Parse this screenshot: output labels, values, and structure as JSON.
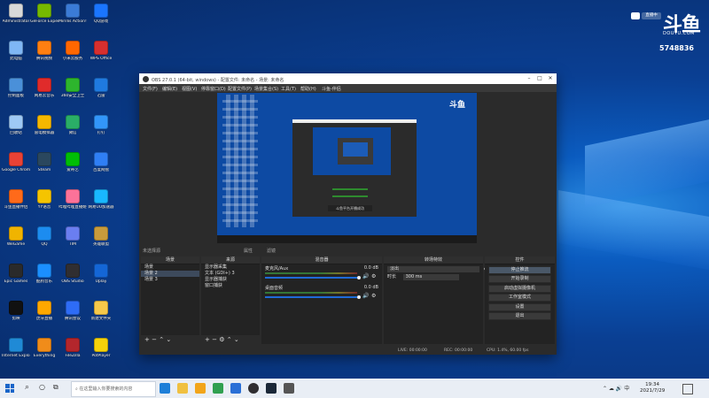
{
  "desktop": {
    "icons": [
      {
        "label": "Administrator",
        "color": "#d9d9d9"
      },
      {
        "label": "GeForce Experience",
        "color": "#76b900"
      },
      {
        "label": "Mirillis Action!",
        "color": "#3b7bd6"
      },
      {
        "label": "QQ游戏",
        "color": "#1a75ff"
      },
      {
        "label": "此电脑",
        "color": "#7fb7f5"
      },
      {
        "label": "腾讯视频",
        "color": "#ff7f11"
      },
      {
        "label": "小米云服务",
        "color": "#ff6700"
      },
      {
        "label": "WPS Office",
        "color": "#d72f2f"
      },
      {
        "label": "控制面板",
        "color": "#4a90d9"
      },
      {
        "label": "网易云音乐",
        "color": "#e02b2b"
      },
      {
        "label": "360安全卫士",
        "color": "#2db52d"
      },
      {
        "label": "迅雷",
        "color": "#1f7ae0"
      },
      {
        "label": "回收站",
        "color": "#9ec9f5"
      },
      {
        "label": "雷电模拟器",
        "color": "#f5b800"
      },
      {
        "label": "微信",
        "color": "#2aae67"
      },
      {
        "label": "钉钉",
        "color": "#3296fa"
      },
      {
        "label": "Google Chrome",
        "color": "#e94235"
      },
      {
        "label": "Steam",
        "color": "#2a475e"
      },
      {
        "label": "爱奇艺",
        "color": "#00be06"
      },
      {
        "label": "百度网盘",
        "color": "#2f7ff5"
      },
      {
        "label": "斗鱼直播伴侣",
        "color": "#ff6a1a"
      },
      {
        "label": "YY语音",
        "color": "#f5c400"
      },
      {
        "label": "哔哩哔哩直播姬",
        "color": "#fb7299"
      },
      {
        "label": "网易UU加速器",
        "color": "#19b8ff"
      },
      {
        "label": "WeGame",
        "color": "#f0b400"
      },
      {
        "label": "QQ",
        "color": "#1c8cf0"
      },
      {
        "label": "TIM",
        "color": "#6a7ef0"
      },
      {
        "label": "英雄联盟",
        "color": "#c89b3c"
      },
      {
        "label": "Epic Games",
        "color": "#2a2a2a"
      },
      {
        "label": "酷狗音乐",
        "color": "#1b8fff"
      },
      {
        "label": "OBS Studio",
        "color": "#302e31"
      },
      {
        "label": "Uplay",
        "color": "#1466d6"
      },
      {
        "label": "剪映",
        "color": "#111111"
      },
      {
        "label": "虎牙直播",
        "color": "#ffa800"
      },
      {
        "label": "腾讯会议",
        "color": "#2e6cf6"
      },
      {
        "label": "新建文件夹",
        "color": "#f6c84a"
      },
      {
        "label": "Internet Explorer",
        "color": "#1f8ad6"
      },
      {
        "label": "Everything",
        "color": "#f08c1a"
      },
      {
        "label": "FileZilla",
        "color": "#b3262c"
      },
      {
        "label": "PotPlayer",
        "color": "#f5d20a"
      }
    ]
  },
  "douyu": {
    "tag": "直播中",
    "logo": "斗鱼",
    "domain": "DOUYU.COM",
    "room_id": "5748836"
  },
  "obs": {
    "title": "OBS 27.0.1 (64-bit, windows) - 配置文件: 未命名 - 场景: 未命名",
    "menu": [
      "文件(F)",
      "编辑(E)",
      "视图(V)",
      "停靠窗口(D)",
      "配置文件(P)",
      "场景集合(S)",
      "工具(T)",
      "帮助(H)",
      "斗鱼-伴侣"
    ],
    "preview_toast": "斗鱼平台开播成功",
    "no_source": "未选择源",
    "props_button": "属性",
    "filters_button": "滤镜",
    "scenes": {
      "header": "场景",
      "items": [
        "场景",
        "场景 2",
        "场景 3"
      ],
      "selected": 1
    },
    "sources": {
      "header": "来源",
      "items": [
        "显示器采集",
        "文本 (GDI+) 3",
        "显示器捕获",
        "窗口捕获"
      ]
    },
    "mixer": {
      "header": "混音器",
      "tracks": [
        {
          "name": "麦克风/Aux",
          "db": "0.0 dB"
        },
        {
          "name": "桌面音频",
          "db": "0.0 dB"
        }
      ]
    },
    "transitions": {
      "header": "转场特效",
      "type": "淡出",
      "duration_label": "时长",
      "duration": "300 ms"
    },
    "controls": {
      "header": "控件",
      "buttons": [
        "停止推流",
        "开始录制",
        "启动虚拟摄像机",
        "工作室模式",
        "设置",
        "退出"
      ]
    },
    "status": {
      "live": "LIVE: 00:00:00",
      "rec": "REC: 00:00:00",
      "cpu": "CPU: 1.4%, 60.00 fps"
    }
  },
  "taskbar": {
    "search_placeholder": "在这里输入你要搜索的内容",
    "time": "19:34",
    "date": "2021/7/29"
  }
}
